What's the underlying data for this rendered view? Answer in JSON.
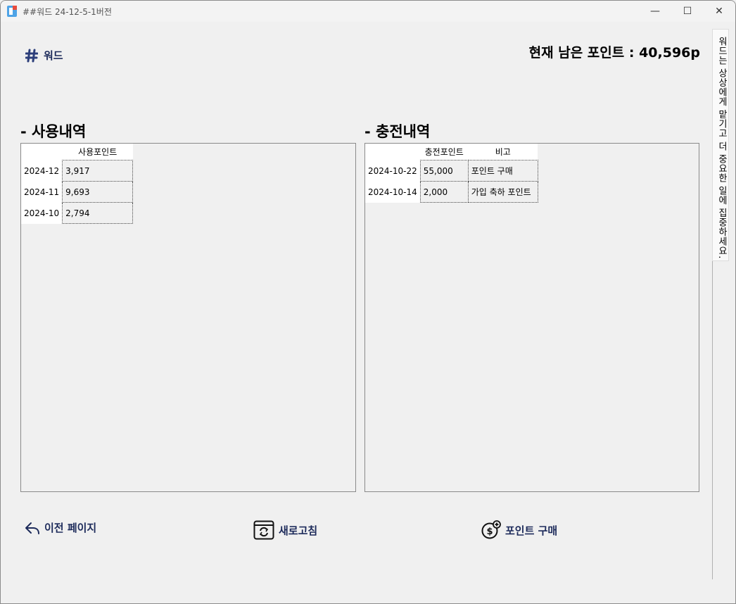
{
  "window": {
    "title": "##워드 24-12-5-1버전",
    "min_glyph": "—",
    "max_glyph": "☐",
    "close_glyph": "✕"
  },
  "header": {
    "logo_text": "워드",
    "points_text": "현재 남은 포인트 : 40,596p"
  },
  "usage": {
    "title": "- 사용내역",
    "col_header": "사용포인트",
    "rows": [
      {
        "month": "2024-12",
        "points": "3,917"
      },
      {
        "month": "2024-11",
        "points": "9,693"
      },
      {
        "month": "2024-10",
        "points": "2,794"
      }
    ]
  },
  "charge": {
    "title": "- 충전내역",
    "col_points": "충전포인트",
    "col_note": "비고",
    "rows": [
      {
        "date": "2024-10-22",
        "points": "55,000",
        "note": "포인트 구매"
      },
      {
        "date": "2024-10-14",
        "points": "2,000",
        "note": "가입 축하 포인트"
      }
    ]
  },
  "side_tab": {
    "text": "워드는 상상에게 맡기고 더 중요한 일에 집중하세요."
  },
  "buttons": {
    "back": "이전 페이지",
    "refresh": "새로고침",
    "buy": "포인트 구매"
  },
  "colors": {
    "accent": "#1c2a5a"
  }
}
